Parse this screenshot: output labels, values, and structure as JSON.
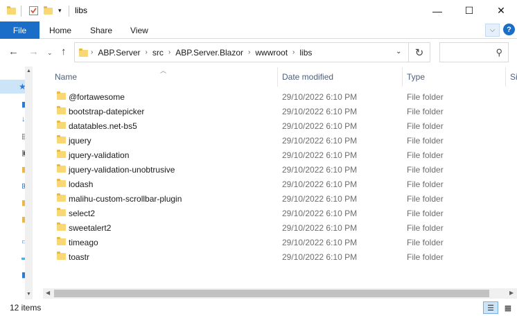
{
  "window": {
    "title": "libs",
    "controls": {
      "minimize": "—",
      "maximize": "☐",
      "close": "✕"
    }
  },
  "ribbon": {
    "file": "File",
    "tabs": [
      "Home",
      "Share",
      "View"
    ]
  },
  "address": {
    "crumbs": [
      "ABP.Server",
      "src",
      "ABP.Server.Blazor",
      "wwwroot",
      "libs"
    ],
    "search_placeholder": ""
  },
  "columns": {
    "name": "Name",
    "date": "Date modified",
    "type": "Type",
    "size": "Si"
  },
  "files": [
    {
      "name": "@fortawesome",
      "date": "29/10/2022 6:10 PM",
      "type": "File folder"
    },
    {
      "name": "bootstrap-datepicker",
      "date": "29/10/2022 6:10 PM",
      "type": "File folder"
    },
    {
      "name": "datatables.net-bs5",
      "date": "29/10/2022 6:10 PM",
      "type": "File folder"
    },
    {
      "name": "jquery",
      "date": "29/10/2022 6:10 PM",
      "type": "File folder"
    },
    {
      "name": "jquery-validation",
      "date": "29/10/2022 6:10 PM",
      "type": "File folder"
    },
    {
      "name": "jquery-validation-unobtrusive",
      "date": "29/10/2022 6:10 PM",
      "type": "File folder"
    },
    {
      "name": "lodash",
      "date": "29/10/2022 6:10 PM",
      "type": "File folder"
    },
    {
      "name": "malihu-custom-scrollbar-plugin",
      "date": "29/10/2022 6:10 PM",
      "type": "File folder"
    },
    {
      "name": "select2",
      "date": "29/10/2022 6:10 PM",
      "type": "File folder"
    },
    {
      "name": "sweetalert2",
      "date": "29/10/2022 6:10 PM",
      "type": "File folder"
    },
    {
      "name": "timeago",
      "date": "29/10/2022 6:10 PM",
      "type": "File folder"
    },
    {
      "name": "toastr",
      "date": "29/10/2022 6:10 PM",
      "type": "File folder"
    }
  ],
  "status": {
    "item_count": "12 items"
  },
  "colors": {
    "accent": "#1a6ec8",
    "selection": "#cce4f7",
    "folder": "#f8d775"
  }
}
